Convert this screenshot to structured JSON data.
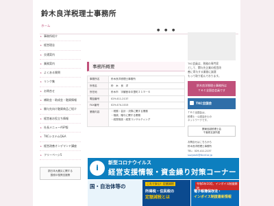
{
  "site_title": "鈴木良洋税理士事務所",
  "topnav": {
    "first_label": "ホーム"
  },
  "sidebar": {
    "items": [
      {
        "label": "事務所紹介"
      },
      {
        "label": "経営理念"
      },
      {
        "label": "交通案内"
      },
      {
        "label": "業務案内"
      },
      {
        "label": "よくある質問"
      },
      {
        "label": "リンク集"
      },
      {
        "label": "お問合せ"
      },
      {
        "label": "補助金・助成金・融資情報"
      },
      {
        "label": "開与先向け融資商品ご紹介"
      },
      {
        "label": "経営者お役立ち情報"
      },
      {
        "label": "社長メニューASP版"
      },
      {
        "label": "TKCシステムQ&A"
      },
      {
        "label": "経営改善オンデマンド講座"
      },
      {
        "label": "フリーページ5"
      }
    ],
    "banner": "損日本大震災に関する\n国税の復興支援策"
  },
  "main": {
    "section_title": "事務所概要",
    "info": [
      {
        "key": "事務所名",
        "value": "鈴木良洋税理士事務所"
      },
      {
        "key": "所長名",
        "value": "鈴　木　良　洋"
      },
      {
        "key": "所在地",
        "value": "鈴木市　字観音寺中里町２１９－６"
      },
      {
        "key": "電話番号",
        "value": "029-411-2137"
      },
      {
        "key": "FAX番号",
        "value": "029-474-1015"
      }
    ],
    "business": {
      "key": "業務内容",
      "lines": [
        "・税務・会計・決算に関する業務",
        "・相続、贈与に関する業務",
        "・経営相談・経営コンサルティング"
      ]
    }
  },
  "banners": {
    "corona_circle": "i",
    "corona_line1": "新型コロナウイルス",
    "corona_line2": "経営支援情報・資金繰り対策コーナー",
    "b1": "国・自治体等の",
    "b2_tag": "これで安心！定額減税",
    "b2_line1": "所得税・住民税の",
    "b2_line2": "定額減税とは",
    "b3_tag": "令和5年10月、インボイス制度開始",
    "b3_line1": "電子帳簿保存法・",
    "b3_line2": "インボイス制度最新情報"
  },
  "right": {
    "text": "TKC会員は、税務の専門家\nとして、関与先企業の経営改\n善に寄与する業務に誠意\nもって取り組んでおります。",
    "pink": "鈴木良洋税理士事務所は\nＴＫＣ全国会会員です",
    "tkc": "TKC全国会",
    "tktext": "ＴＫＣ全国会は、\n税理士・公認会計士の\nネットワークです。",
    "box": "関東信越税理士会\n千葉県支部所属",
    "contact_label": "お問合せはこちらから",
    "contact_name": "鈴木良洋税理士事務所",
    "contact_tel": "TEL：029-411-2137",
    "contact_mail": "suzyoshi@tkcnf.or.jp"
  }
}
